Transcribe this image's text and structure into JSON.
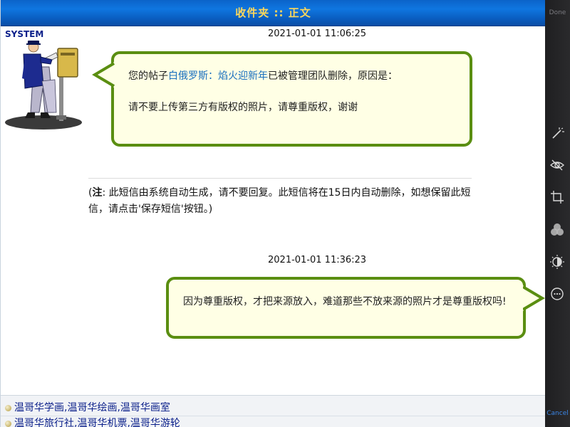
{
  "header": {
    "title": "收件夹 :: 正文"
  },
  "message1": {
    "sender": "SYSTEM",
    "timestamp": "2021-01-01 11:06:25",
    "text_prefix": "您的帖子",
    "post_title": "白俄罗斯：焰火迎新年",
    "text_suffix": "已被管理团队删除，原因是：",
    "reason": "请不要上传第三方有版权的照片，请尊重版权，谢谢"
  },
  "note": {
    "label": "注",
    "text": ": 此短信由系统自动生成，请不要回复。此短信将在15日内自动删除，如想保留此短信，请点击'保存短信'按钮。)"
  },
  "message2": {
    "timestamp": "2021-01-01 11:36:23",
    "text": "因为尊重版权，才把来源放入，难道那些不放来源的照片才是尊重版权吗!"
  },
  "links": [
    "温哥华学画,温哥华绘画,温哥华画室",
    "温哥华旅行社,温哥华机票,温哥华游轮"
  ],
  "toolbar": {
    "done_label": "Done",
    "cancel_label": "Cancel",
    "icons": [
      "magic-wand-icon",
      "eye-slash-icon",
      "crop-rotate-icon",
      "color-filters-icon",
      "adjust-icon",
      "more-icon"
    ]
  },
  "colors": {
    "header_blue": "#0f76e0",
    "header_text": "#ffd85a",
    "bubble_border": "#5a8e11",
    "bubble_fill": "#ffffe5",
    "link_blue": "#1a6fbf",
    "cancel_blue": "#3b86e6"
  }
}
